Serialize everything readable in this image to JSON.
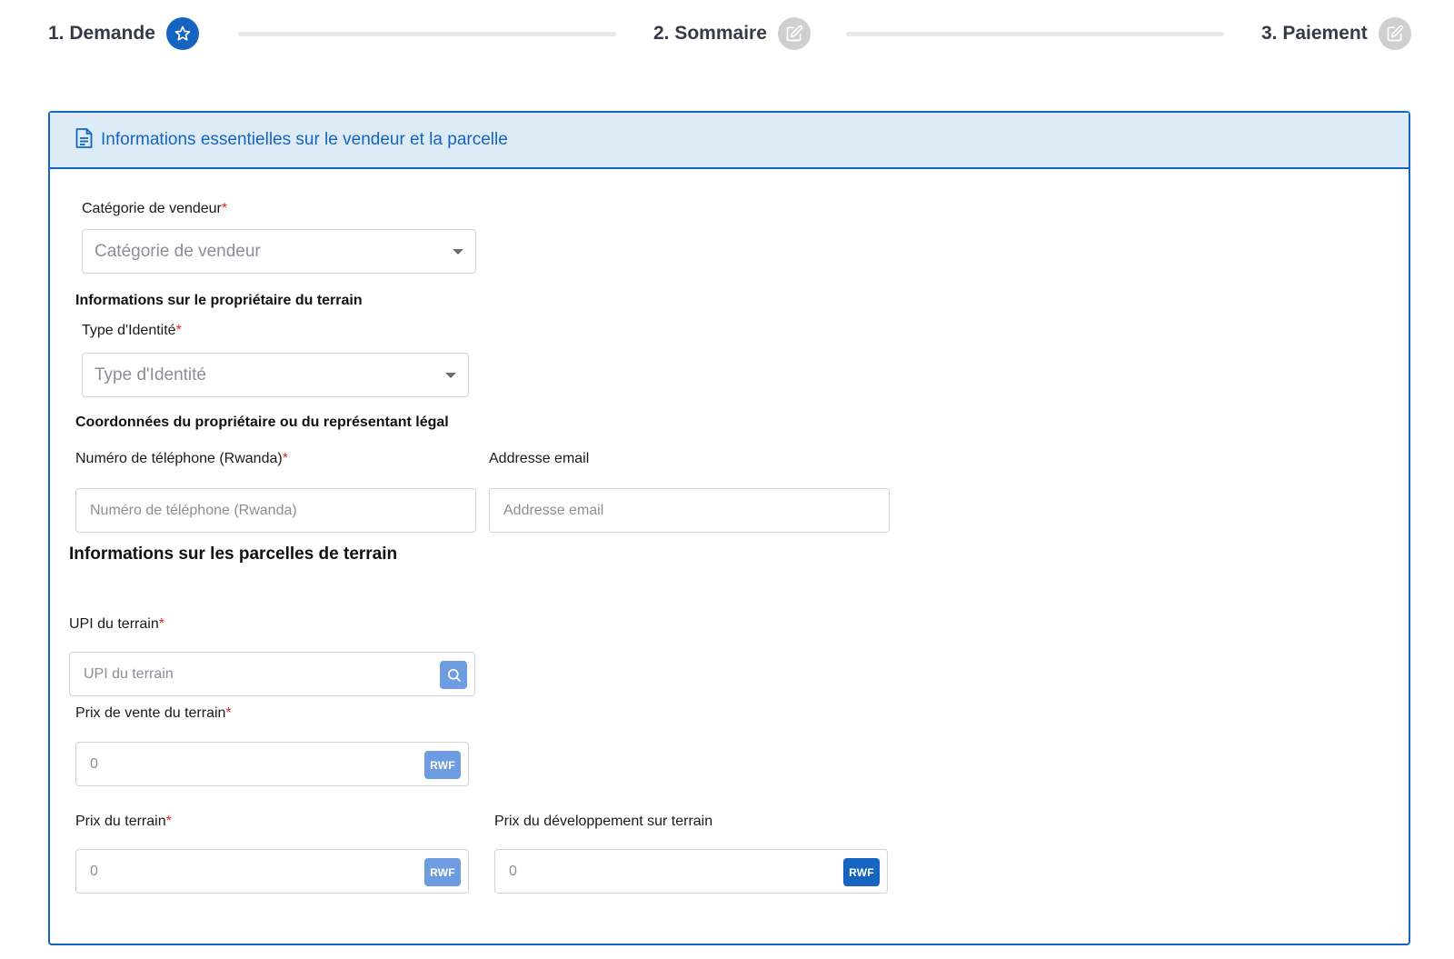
{
  "stepper": {
    "steps": [
      {
        "label": "1. Demande",
        "icon": "star-icon",
        "state": "active"
      },
      {
        "label": "2. Sommaire",
        "icon": "edit-icon",
        "state": "inactive"
      },
      {
        "label": "3. Paiement",
        "icon": "edit-icon",
        "state": "inactive"
      }
    ]
  },
  "card": {
    "icon": "document-icon",
    "title": "Informations essentielles sur le vendeur et la parcelle"
  },
  "form": {
    "seller_category": {
      "label": "Catégorie de vendeur",
      "required_mark": "*",
      "placeholder": "Catégorie de vendeur"
    },
    "owner_section_title": "Informations sur le propriétaire du terrain",
    "identity_type": {
      "label": "Type d'Identité",
      "required_mark": "*",
      "placeholder": "Type d'Identité"
    },
    "contact_section_title": "Coordonnées du propriétaire ou du représentant légal",
    "phone": {
      "label": "Numéro de téléphone (Rwanda)",
      "required_mark": "*",
      "placeholder": "Numéro de téléphone (Rwanda)"
    },
    "email": {
      "label": "Addresse email",
      "placeholder": "Addresse email"
    },
    "parcels_section_title": "Informations sur les parcelles de terrain",
    "upi": {
      "label": "UPI du terrain",
      "required_mark": "*",
      "placeholder": "UPI du terrain",
      "button_icon": "search-icon"
    },
    "sale_price": {
      "label": "Prix de vente du terrain",
      "required_mark": "*",
      "placeholder": "0",
      "addon": "RWF"
    },
    "land_price": {
      "label": "Prix du terrain",
      "required_mark": "*",
      "placeholder": "0",
      "addon": "RWF"
    },
    "development_price": {
      "label": "Prix du développement sur terrain",
      "placeholder": "0",
      "addon": "RWF"
    }
  },
  "colors": {
    "primary": "#1565c0",
    "header_bg": "#ddebf7",
    "addon_light": "#6d9de0",
    "required": "#e0242c",
    "inactive_step": "#cfcfcf"
  }
}
